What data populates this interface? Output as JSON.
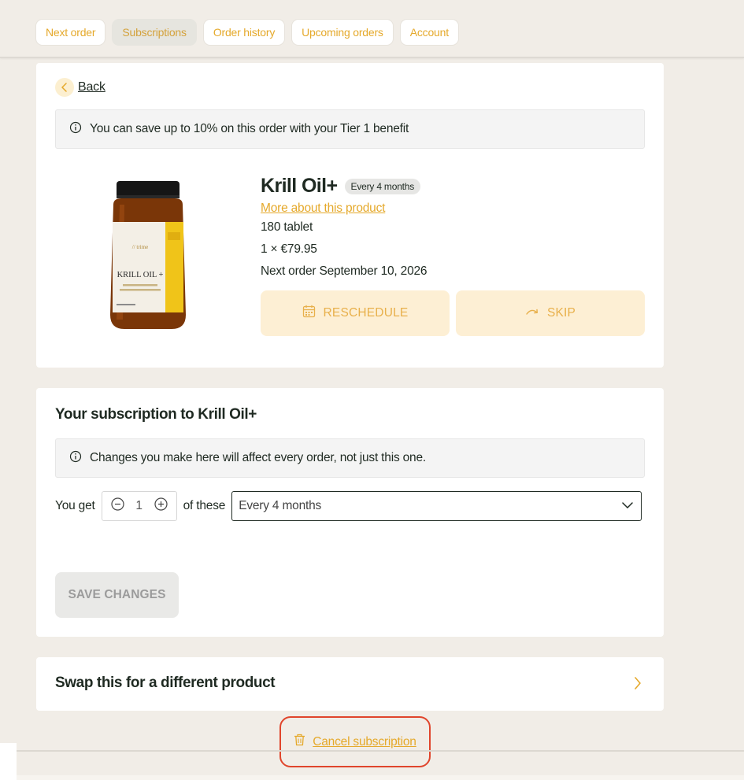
{
  "tabs": [
    {
      "label": "Next order",
      "active": false
    },
    {
      "label": "Subscriptions",
      "active": true
    },
    {
      "label": "Order history",
      "active": false
    },
    {
      "label": "Upcoming orders",
      "active": false
    },
    {
      "label": "Account",
      "active": false
    }
  ],
  "back_label": "Back",
  "tier_notice": "You can save up to 10% on this order with your Tier 1 benefit",
  "product": {
    "name": "Krill Oil+",
    "frequency_badge": "Every 4 months",
    "more_link": "More about this product",
    "size": "180 tablet",
    "price_line": "1 × €79.95",
    "next_order": "Next order September 10, 2026",
    "label_text": "KRILL OIL +"
  },
  "actions": {
    "reschedule_label": "RESCHEDULE",
    "skip_label": "SKIP"
  },
  "subscription": {
    "title": "Your subscription to Krill Oil+",
    "notice": "Changes you make here will affect every order, not just this one.",
    "you_get_label": "You get",
    "quantity": "1",
    "of_these_label": "of these",
    "frequency_selected": "Every 4 months",
    "save_label": "SAVE CHANGES"
  },
  "swap": {
    "title": "Swap this for a different product"
  },
  "cancel_label": "Cancel subscription",
  "colors": {
    "accent": "#e5a92b",
    "background": "#f1ede7",
    "highlight": "#e0452c"
  }
}
